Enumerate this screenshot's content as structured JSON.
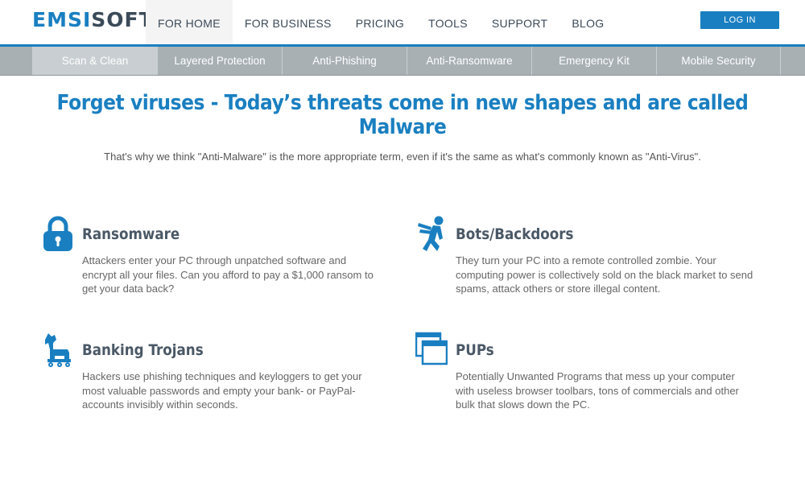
{
  "logo": {
    "part1": "EMSI",
    "part2": "SOFT"
  },
  "nav": {
    "items": [
      "FOR HOME",
      "FOR BUSINESS",
      "PRICING",
      "TOOLS",
      "SUPPORT",
      "BLOG"
    ],
    "login": "LOG IN"
  },
  "subnav": {
    "items": [
      "Scan & Clean",
      "Layered Protection",
      "Anti-Phishing",
      "Anti-Ransomware",
      "Emergency Kit",
      "Mobile Security"
    ]
  },
  "headline": "Forget viruses - Today’s threats come in new shapes and are called Malware",
  "subline": "That's why we think \"Anti-Malware\" is the more appropriate term, even if it's the same as what's commonly known as \"Anti-Virus\".",
  "features": [
    {
      "icon": "lock-icon",
      "title": "Ransomware",
      "text": "Attackers enter your PC through unpatched software and encrypt all your files. Can you afford to pay a $1,000 ransom to get your data back?"
    },
    {
      "icon": "zombie-icon",
      "title": "Bots/Backdoors",
      "text": "They turn your PC into a remote controlled zombie. Your computing power is collectively sold on the black market to send spams, attack others or store illegal content."
    },
    {
      "icon": "trojan-horse-icon",
      "title": "Banking Trojans",
      "text": "Hackers use phishing techniques and keyloggers to get your most valuable passwords and empty your bank- or PayPal-accounts invisibly within seconds."
    },
    {
      "icon": "browser-windows-icon",
      "title": "PUPs",
      "text": "Potentially Unwanted Programs that mess up your computer with useless browser toolbars, tons of commercials and other bulk that slows down the PC."
    }
  ],
  "colors": {
    "brand": "#1a7fc1",
    "dark": "#3b4a58",
    "subnav": "#a8b0b4"
  }
}
